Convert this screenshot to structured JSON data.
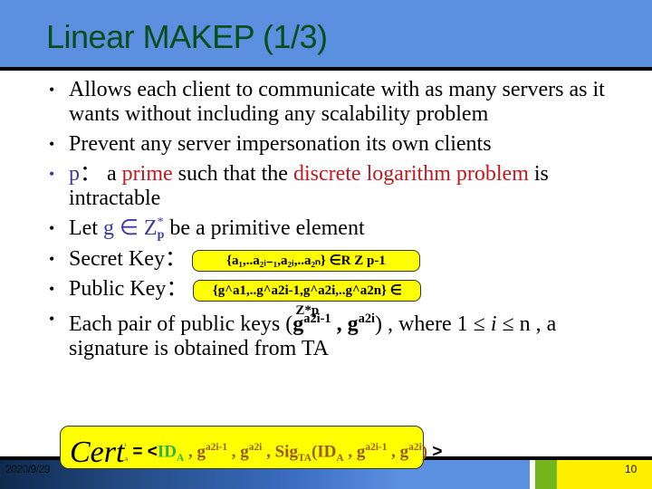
{
  "slide": {
    "title": "Linear MAKEP (1/3)",
    "bullets": {
      "b1": "Allows each client to communicate with as many servers as it wants without including any scalability problem",
      "b2": "Prevent any server impersonation its own clients",
      "b3": {
        "var": "p",
        "sep": "：",
        "t1": " a ",
        "prime": "prime",
        "t2": " such that the ",
        "dlp": "discrete logarithm problem",
        "t3": " is intractable"
      },
      "b4": {
        "t1": "Let ",
        "g": "g ∈ Z",
        "sup": "*",
        "sub": "p",
        "t2": " be a primitive element"
      },
      "b5": {
        "label": "Secret Key：",
        "box": "{a₁,..a₂ᵢ₋₁,a₂ᵢ,..a₂ₙ} ∈R Z p-1"
      },
      "b6": {
        "label": "Public Key：",
        "box": "{g^a1,..g^a2i-1,g^a2i,..g^a2n} ∈ Z*p"
      },
      "b7": {
        "t1": "Each pair of public keys (",
        "k1": "g",
        "k1sup": "a2i-1",
        "comma": " , ",
        "k2": "g",
        "k2sup": "a2i",
        "t2": ") , where 1 ≤ ",
        "i": "i",
        "t3": " ≤ n , a signature is obtained from TA"
      }
    },
    "cert": {
      "word": "Cert",
      "sup": "i",
      "sub": "A",
      "eq": " = <",
      "id": "ID",
      "idsub": "A",
      "c1": " , g",
      "s1": "a2i-1",
      "c2": " , g",
      "s2": "a2i",
      "c3": " , ",
      "sig": "Sig",
      "sigsub": "TA",
      "open": "(",
      "id2": "ID",
      "id2sub": "A",
      "c4": " , g",
      "s3": "a2i-1",
      "c5": " , g",
      "s4": "a2i",
      "close": ")",
      "end": " >"
    },
    "footer": {
      "date": "2020/9/29",
      "page": "10"
    }
  }
}
